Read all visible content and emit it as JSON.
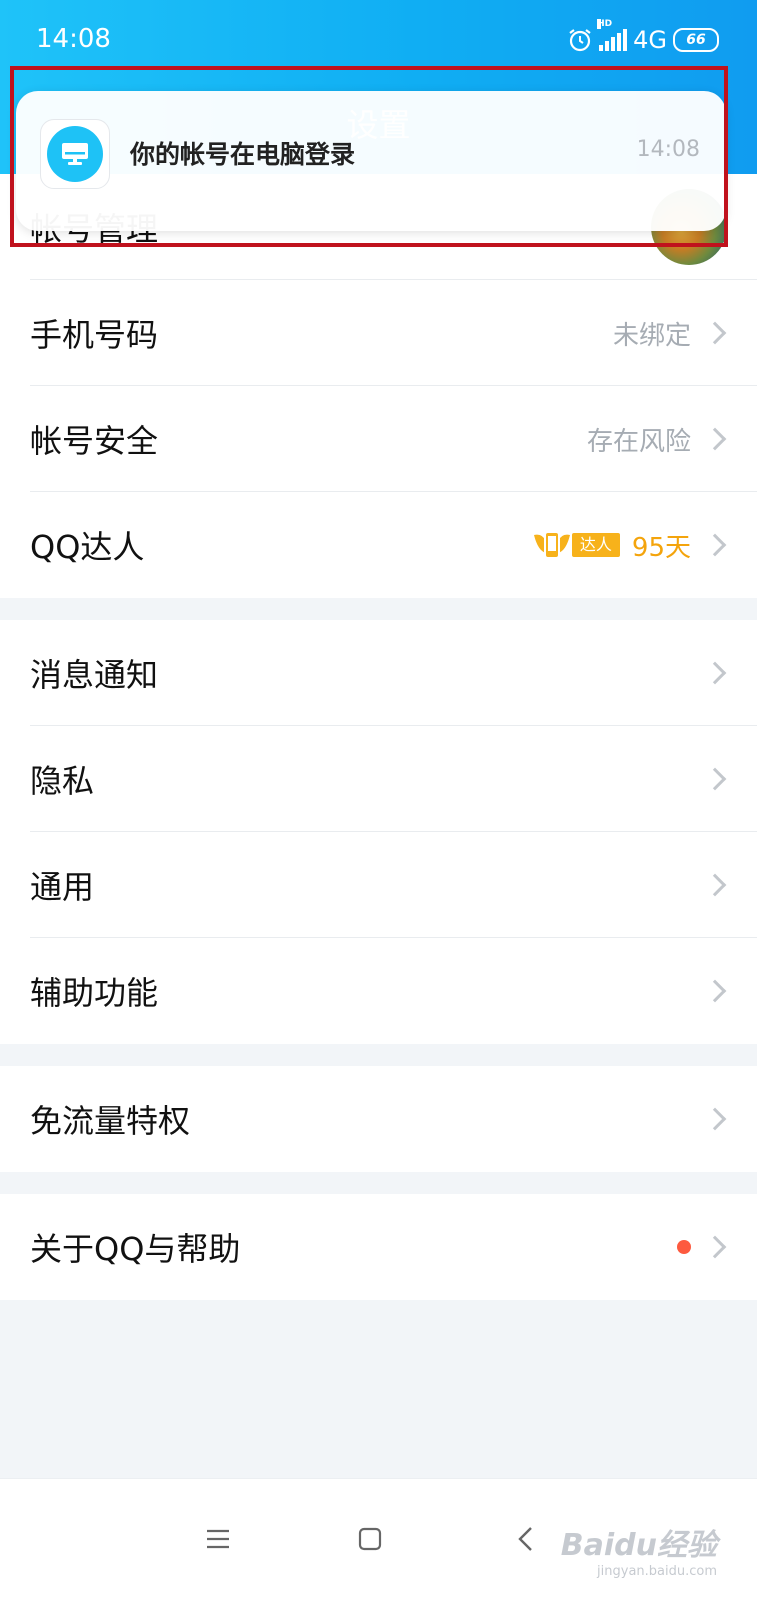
{
  "status_bar": {
    "time": "14:08",
    "network": "4G",
    "battery": "66"
  },
  "header": {
    "title": "设置"
  },
  "notification": {
    "message": "你的帐号在电脑登录",
    "time": "14:08",
    "icon": "computer-icon"
  },
  "groups": [
    {
      "items": [
        {
          "label": "帐号管理",
          "value": "",
          "accessory": "avatar"
        },
        {
          "label": "手机号码",
          "value": "未绑定"
        },
        {
          "label": "帐号安全",
          "value": "存在风险"
        },
        {
          "label": "QQ达人",
          "badge": "达人",
          "days": "95天"
        }
      ]
    },
    {
      "items": [
        {
          "label": "消息通知"
        },
        {
          "label": "隐私"
        },
        {
          "label": "通用"
        },
        {
          "label": "辅助功能"
        }
      ]
    },
    {
      "items": [
        {
          "label": "免流量特权"
        }
      ]
    },
    {
      "items": [
        {
          "label": "关于QQ与帮助",
          "red_dot": true
        }
      ]
    }
  ],
  "watermark": {
    "brand": "Baidu经验",
    "site": "jingyan.baidu.com"
  },
  "colors": {
    "header_blue": "#10aef3",
    "highlight_red": "#c0121d",
    "badge_orange": "#f7b21b",
    "red_dot": "#fd5a3f"
  }
}
